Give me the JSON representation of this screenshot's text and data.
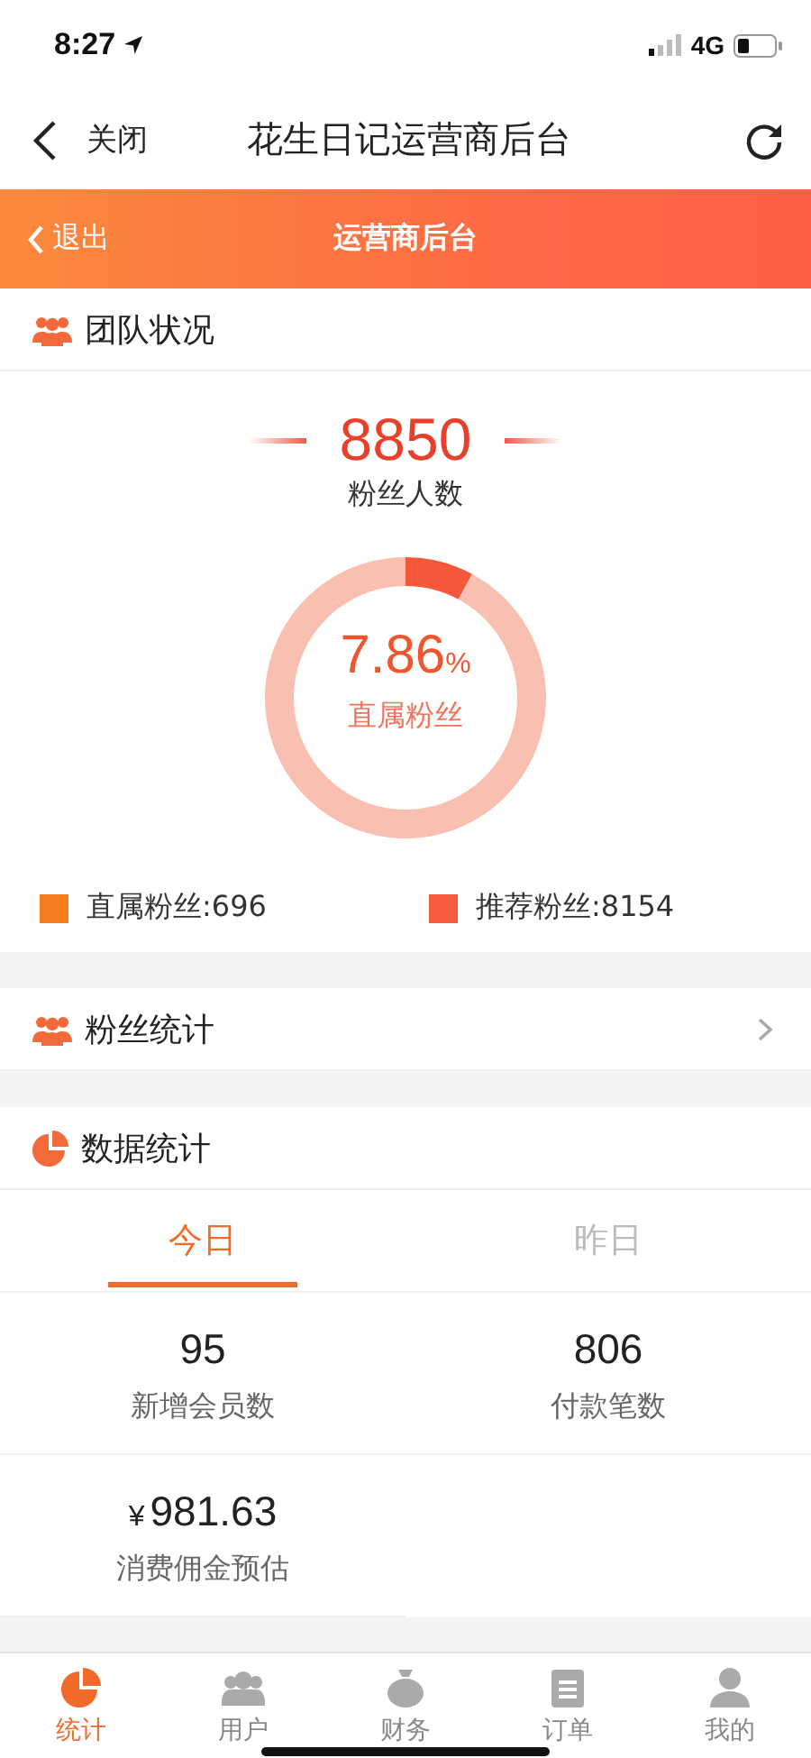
{
  "status_bar": {
    "time": "8:27",
    "network": "4G"
  },
  "nav_bar": {
    "back_label": "关闭",
    "title": "花生日记运营商后台"
  },
  "header": {
    "back_label": "退出",
    "title": "运营商后台"
  },
  "team": {
    "title": "团队状况",
    "total": "8850",
    "total_label": "粉丝人数",
    "ring": {
      "chart_data": {
        "type": "donut",
        "values": [
          7.86,
          92.14
        ]
      },
      "percent": "7.86",
      "unit": "%",
      "label": "直属粉丝"
    },
    "legend": [
      {
        "label": "直属粉丝:696",
        "color": "#f57c1f"
      },
      {
        "label": "推荐粉丝:8154",
        "color": "#f55a3c"
      }
    ]
  },
  "fans_row": {
    "title": "粉丝统计"
  },
  "data_stats": {
    "title": "数据统计",
    "tabs": [
      {
        "label": "今日",
        "selected": true
      },
      {
        "label": "昨日",
        "selected": false
      }
    ],
    "stats": [
      {
        "value": "95",
        "label": "新增会员数"
      },
      {
        "value": "806",
        "label": "付款笔数"
      },
      {
        "currency": "¥",
        "value": "981.63",
        "label": "消费佣金预估"
      }
    ]
  },
  "tab_bar": [
    {
      "kind": "chart",
      "label": "统计",
      "selected": true
    },
    {
      "kind": "users",
      "label": "用户",
      "selected": false
    },
    {
      "kind": "money",
      "label": "财务",
      "selected": false
    },
    {
      "kind": "orders",
      "label": "订单",
      "selected": false
    },
    {
      "kind": "profile",
      "label": "我的",
      "selected": false
    }
  ]
}
